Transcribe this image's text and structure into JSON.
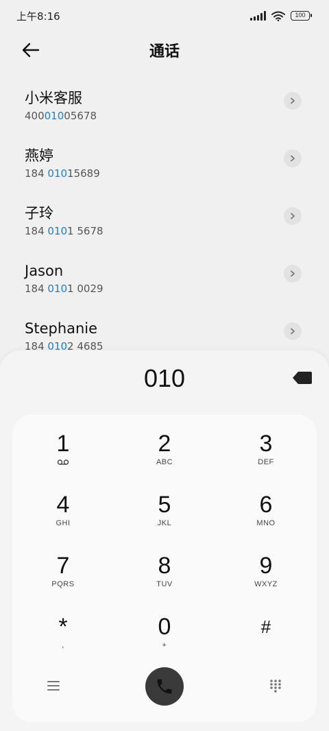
{
  "status_bar": {
    "time": "上午8:16",
    "battery": "100"
  },
  "header": {
    "title": "通话"
  },
  "contacts": [
    {
      "name": "小米客服",
      "num_pre": "400",
      "num_hl": "010",
      "num_post": "05678"
    },
    {
      "name": "燕婷",
      "num_pre": "184 ",
      "num_hl": "010",
      "num_post": "15689"
    },
    {
      "name": "子玲",
      "num_pre": "184 ",
      "num_hl": "010",
      "num_post": "1 5678"
    },
    {
      "name": "Jason",
      "num_pre": "184 ",
      "num_hl": "010",
      "num_post": "1 0029"
    },
    {
      "name": "Stephanie",
      "num_pre": "184 ",
      "num_hl": "010",
      "num_post": "2 4685"
    }
  ],
  "dialer": {
    "input": "010",
    "keys": [
      {
        "digit": "1",
        "letters": ""
      },
      {
        "digit": "2",
        "letters": "ABC"
      },
      {
        "digit": "3",
        "letters": "DEF"
      },
      {
        "digit": "4",
        "letters": "GHI"
      },
      {
        "digit": "5",
        "letters": "JKL"
      },
      {
        "digit": "6",
        "letters": "MNO"
      },
      {
        "digit": "7",
        "letters": "PQRS"
      },
      {
        "digit": "8",
        "letters": "TUV"
      },
      {
        "digit": "9",
        "letters": "WXYZ"
      },
      {
        "digit": "*",
        "letters": ","
      },
      {
        "digit": "0",
        "letters": "+"
      },
      {
        "digit": "#",
        "letters": ""
      }
    ]
  },
  "colors": {
    "highlight": "#1a7fd4",
    "call_button": "#3a3a3a"
  }
}
